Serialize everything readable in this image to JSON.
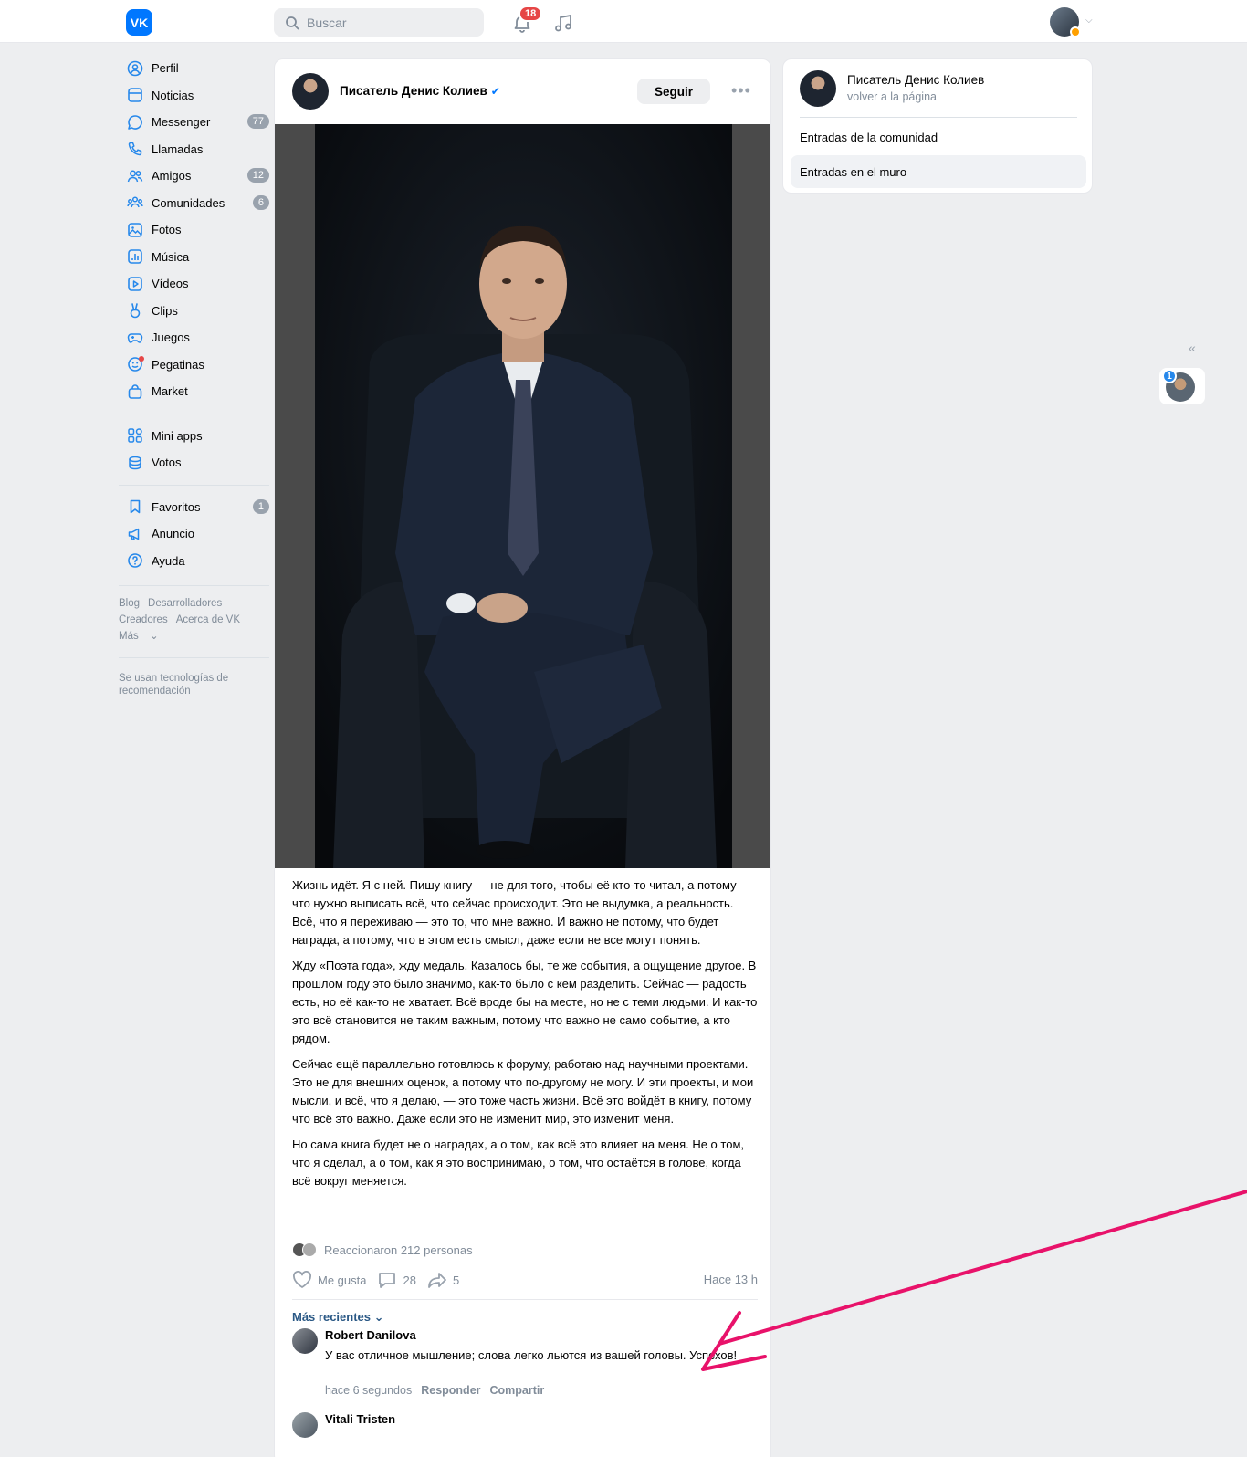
{
  "header": {
    "logo_text": "VK",
    "search_placeholder": "Buscar",
    "notifications_count": "18"
  },
  "nav": {
    "items": [
      {
        "label": "Perfil",
        "icon": "user-circle-icon"
      },
      {
        "label": "Noticias",
        "icon": "news-icon"
      },
      {
        "label": "Messenger",
        "icon": "message-icon",
        "count": "77"
      },
      {
        "label": "Llamadas",
        "icon": "phone-icon"
      },
      {
        "label": "Amigos",
        "icon": "friends-icon",
        "count": "12"
      },
      {
        "label": "Comunidades",
        "icon": "communities-icon",
        "count": "6"
      },
      {
        "label": "Fotos",
        "icon": "photo-icon"
      },
      {
        "label": "Música",
        "icon": "music-icon"
      },
      {
        "label": "Vídeos",
        "icon": "video-icon"
      },
      {
        "label": "Clips",
        "icon": "clips-icon"
      },
      {
        "label": "Juegos",
        "icon": "gamepad-icon"
      },
      {
        "label": "Pegatinas",
        "icon": "sticker-icon"
      },
      {
        "label": "Market",
        "icon": "bag-icon"
      }
    ],
    "items2": [
      {
        "label": "Mini apps",
        "icon": "grid-icon"
      },
      {
        "label": "Votos",
        "icon": "coins-icon"
      }
    ],
    "items3": [
      {
        "label": "Favoritos",
        "icon": "bookmark-icon",
        "count": "1"
      },
      {
        "label": "Anuncio",
        "icon": "megaphone-icon"
      },
      {
        "label": "Ayuda",
        "icon": "help-icon"
      }
    ],
    "footer_links": [
      "Blog",
      "Desarrolladores",
      "Creadores",
      "Acerca de VK",
      "Más"
    ],
    "reco_text": "Se usan tecnologías de recomendación"
  },
  "post": {
    "author": "Писатель Денис Колиев",
    "follow_label": "Seguir",
    "paragraphs": [
      "Жизнь идёт. Я с ней. Пишу книгу — не для того, чтобы её кто-то читал, а потому что нужно выписать всё, что сейчас происходит. Это не выдумка, а реальность. Всё, что я переживаю — это то, что мне важно. И важно не потому, что будет награда, а потому, что в этом есть смысл, даже если не все могут понять.",
      "Жду «Поэта года», жду медаль. Казалось бы, те же события, а ощущение другое. В прошлом году это было значимо, как-то было с кем разделить. Сейчас — радость есть, но её как-то не хватает. Всё вроде бы на месте, но не с теми людьми. И как-то это всё становится не таким важным, потому что важно не само событие, а кто рядом.",
      "Сейчас ещё параллельно готовлюсь к форуму, работаю над научными проектами. Это не для внешних оценок, а потому что по-другому не могу. И эти проекты, и мои мысли, и всё, что я делаю, — это тоже часть жизни. Всё это войдёт в книгу, потому что всё это важно. Даже если это не изменит мир, это изменит меня.",
      "Но сама книга будет не о наградах, а о том, как всё это влияет на меня. Не о том, что я сделал, а о том, как я это воспринимаю, о том, что остаётся в голове, когда всё вокруг меняется."
    ],
    "reactions_text": "Reaccionaron 212 personas",
    "like_label": "Me gusta",
    "comments_count": "28",
    "shares_count": "5",
    "time": "Hace 13 h",
    "sort_label": "Más recientes",
    "comments": [
      {
        "name": "Robert Danilova",
        "text": "У вас отличное мышление; слова легко льются из вашей головы. Успехов!",
        "time": "hace 6 segundos",
        "reply": "Responder",
        "share": "Compartir"
      },
      {
        "name": "Vitali Tristen"
      }
    ]
  },
  "right_panel": {
    "name": "Писатель Денис Колиев",
    "back": "volver a la página",
    "tabs": [
      "Entradas de la comunidad",
      "Entradas en el muro"
    ]
  },
  "chat": {
    "badge": "1"
  },
  "colors": {
    "accent": "#0077ff",
    "annotation_arrow": "#e8126a"
  }
}
